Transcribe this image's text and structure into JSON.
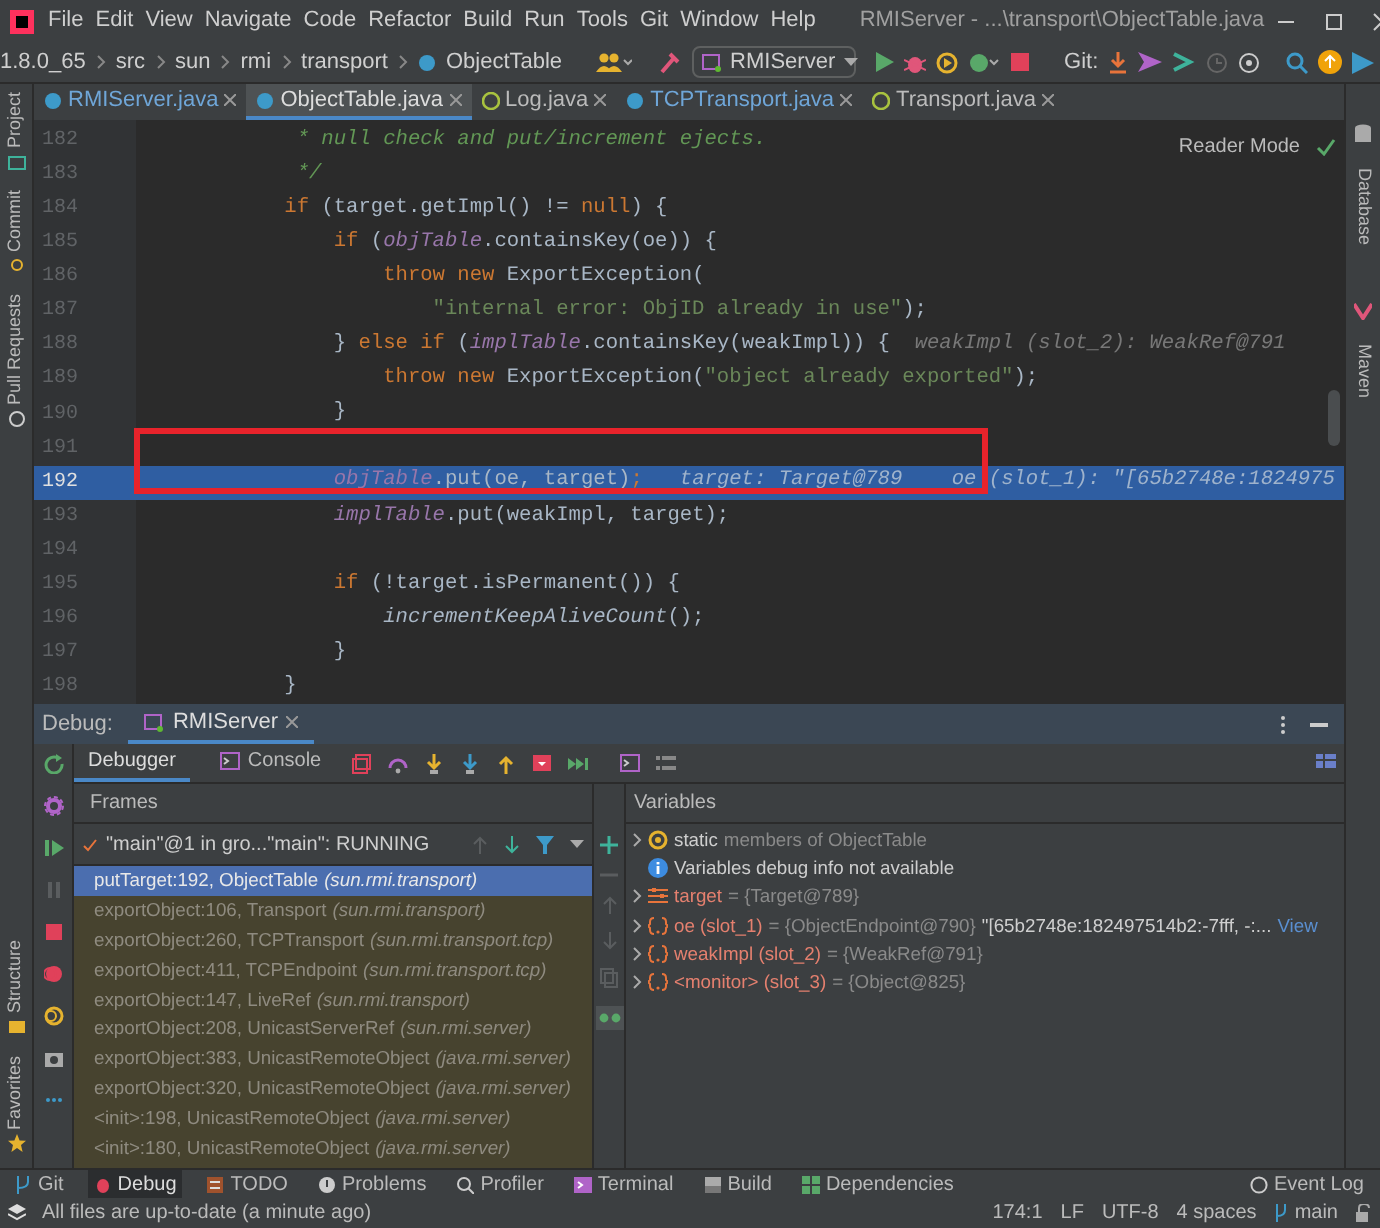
{
  "window": {
    "title": "RMIServer - ...\\transport\\ObjectTable.java"
  },
  "menu": [
    "File",
    "Edit",
    "View",
    "Navigate",
    "Code",
    "Refactor",
    "Build",
    "Run",
    "Tools",
    "Git",
    "Window",
    "Help"
  ],
  "breadcrumbs": [
    "1.8.0_65",
    "src",
    "sun",
    "rmi",
    "transport",
    "ObjectTable"
  ],
  "run_config": "RMIServer",
  "git_label": "Git:",
  "tabs": [
    {
      "label": "RMIServer.java",
      "kind": "class",
      "selected": false
    },
    {
      "label": "ObjectTable.java",
      "kind": "class",
      "selected": true
    },
    {
      "label": "Log.java",
      "kind": "interface",
      "selected": false
    },
    {
      "label": "TCPTransport.java",
      "kind": "class",
      "selected": false
    },
    {
      "label": "Transport.java",
      "kind": "interface",
      "selected": false
    }
  ],
  "left_tool_windows": [
    "Project",
    "Commit",
    "Pull Requests"
  ],
  "left_tool_windows_lower": [
    "Structure",
    "Favorites"
  ],
  "right_tool_windows": [
    "Database",
    "Maven"
  ],
  "editor": {
    "reader_mode": "Reader Mode",
    "highlight_frame": true,
    "lines": [
      {
        "number": "182",
        "current": false,
        "tokens": [
          {
            "kind": "comment",
            "text": "             * null check and put/increment ejects."
          }
        ]
      },
      {
        "number": "183",
        "current": false,
        "tokens": [
          {
            "kind": "comment",
            "text": "             */"
          }
        ]
      },
      {
        "number": "184",
        "current": false,
        "tokens": [
          {
            "kind": "keyword",
            "text": "            if"
          },
          {
            "kind": "plain",
            "text": " (target.getImpl() != "
          },
          {
            "kind": "keyword",
            "text": "null"
          },
          {
            "kind": "plain",
            "text": ") {"
          }
        ]
      },
      {
        "number": "185",
        "current": false,
        "tokens": [
          {
            "kind": "keyword",
            "text": "                if"
          },
          {
            "kind": "plain",
            "text": " ("
          },
          {
            "kind": "field",
            "text": "objTable"
          },
          {
            "kind": "plain",
            "text": ".containsKey(oe)) {"
          }
        ]
      },
      {
        "number": "186",
        "current": false,
        "tokens": [
          {
            "kind": "keyword",
            "text": "                    throw new"
          },
          {
            "kind": "plain",
            "text": " ExportException("
          }
        ]
      },
      {
        "number": "187",
        "current": false,
        "tokens": [
          {
            "kind": "string",
            "text": "                        \"internal error: ObjID already in use\""
          },
          {
            "kind": "plain",
            "text": ");"
          }
        ]
      },
      {
        "number": "188",
        "current": false,
        "tokens": [
          {
            "kind": "plain",
            "text": "                } "
          },
          {
            "kind": "keyword",
            "text": "else if"
          },
          {
            "kind": "plain",
            "text": " ("
          },
          {
            "kind": "field",
            "text": "implTable"
          },
          {
            "kind": "plain",
            "text": ".containsKey(weakImpl)) {"
          },
          {
            "kind": "hint",
            "text": "  weakImpl (slot_2): WeakRef@791"
          }
        ]
      },
      {
        "number": "189",
        "current": false,
        "tokens": [
          {
            "kind": "keyword",
            "text": "                    throw new"
          },
          {
            "kind": "plain",
            "text": " ExportException("
          },
          {
            "kind": "string",
            "text": "\"object already exported\""
          },
          {
            "kind": "plain",
            "text": ");"
          }
        ]
      },
      {
        "number": "190",
        "current": false,
        "tokens": [
          {
            "kind": "plain",
            "text": "                }"
          }
        ]
      },
      {
        "number": "191",
        "current": false
      },
      {
        "number": "192",
        "current": true,
        "tokens": [
          {
            "kind": "field",
            "text": "                objTable"
          },
          {
            "kind": "plain",
            "text": ".put(oe, target)"
          },
          {
            "kind": "keyword",
            "text": ";"
          },
          {
            "kind": "hint",
            "text": "   target: Target@789"
          },
          {
            "kind": "hint",
            "text": "    oe (slot_1): \"[65b2748e:1824975"
          }
        ]
      },
      {
        "number": "193",
        "current": false,
        "tokens": [
          {
            "kind": "field",
            "text": "                implTable"
          },
          {
            "kind": "plain",
            "text": ".put(weakImpl, target);"
          }
        ]
      },
      {
        "number": "194",
        "current": false
      },
      {
        "number": "195",
        "current": false,
        "tokens": [
          {
            "kind": "keyword",
            "text": "                if"
          },
          {
            "kind": "plain",
            "text": " (!target.isPermanent()) {"
          }
        ]
      },
      {
        "number": "196",
        "current": false,
        "tokens": [
          {
            "kind": "call",
            "text": "                    incrementKeepAliveCount"
          },
          {
            "kind": "plain",
            "text": "();"
          }
        ]
      },
      {
        "number": "197",
        "current": false,
        "tokens": [
          {
            "kind": "plain",
            "text": "                }"
          }
        ]
      },
      {
        "number": "198",
        "current": false,
        "tokens": [
          {
            "kind": "plain",
            "text": "            }"
          }
        ]
      }
    ]
  },
  "debug": {
    "title": "Debug:",
    "session": "RMIServer",
    "tabs": [
      {
        "label": "Debugger",
        "selected": true
      },
      {
        "label": "Console",
        "selected": false
      }
    ],
    "frames_header": "Frames",
    "variables_header": "Variables",
    "thread": "\"main\"@1 in gro...\"main\": RUNNING",
    "frames": [
      {
        "method": "putTarget:192, ObjectTable",
        "package": "(sun.rmi.transport)",
        "selected": true
      },
      {
        "method": "exportObject:106, Transport",
        "package": "(sun.rmi.transport)",
        "selected": false
      },
      {
        "method": "exportObject:260, TCPTransport",
        "package": "(sun.rmi.transport.tcp)",
        "selected": false
      },
      {
        "method": "exportObject:411, TCPEndpoint",
        "package": "(sun.rmi.transport.tcp)",
        "selected": false
      },
      {
        "method": "exportObject:147, LiveRef",
        "package": "(sun.rmi.transport)",
        "selected": false
      },
      {
        "method": "exportObject:208, UnicastServerRef",
        "package": "(sun.rmi.server)",
        "selected": false
      },
      {
        "method": "exportObject:383, UnicastRemoteObject",
        "package": "(java.rmi.server)",
        "selected": false
      },
      {
        "method": "exportObject:320, UnicastRemoteObject",
        "package": "(java.rmi.server)",
        "selected": false
      },
      {
        "method": "<init>:198, UnicastRemoteObject",
        "package": "(java.rmi.server)",
        "selected": false
      },
      {
        "method": "<init>:180, UnicastRemoteObject",
        "package": "(java.rmi.server)",
        "selected": false
      }
    ],
    "variables": [
      {
        "kind": "static",
        "expandable": true,
        "name": "static",
        "value": "members of ObjectTable"
      },
      {
        "kind": "info",
        "expandable": false,
        "name": "Variables debug info not available"
      },
      {
        "kind": "field",
        "expandable": true,
        "name": "target",
        "value": "= {Target@789}"
      },
      {
        "kind": "object",
        "expandable": true,
        "name": "oe (slot_1)",
        "value": "= {ObjectEndpoint@790}",
        "extra": "\"[65b2748e:182497514b2:-7fff, -:...",
        "link": "View"
      },
      {
        "kind": "object",
        "expandable": true,
        "name": "weakImpl (slot_2)",
        "value": "= {WeakRef@791}"
      },
      {
        "kind": "object",
        "expandable": true,
        "name": "<monitor> (slot_3)",
        "value": "= {Object@825}"
      }
    ]
  },
  "tool_tabs": [
    {
      "label": "Git",
      "selected": false
    },
    {
      "label": "Debug",
      "selected": true
    },
    {
      "label": "TODO",
      "selected": false
    },
    {
      "label": "Problems",
      "selected": false
    },
    {
      "label": "Profiler",
      "selected": false
    },
    {
      "label": "Terminal",
      "selected": false
    },
    {
      "label": "Build",
      "selected": false
    },
    {
      "label": "Dependencies",
      "selected": false
    }
  ],
  "event_log": "Event Log",
  "status_bar": {
    "message": "All files are up-to-date (a minute ago)",
    "position": "174:1",
    "line_separator": "LF",
    "encoding": "UTF-8",
    "indent": "4 spaces",
    "branch": "main"
  }
}
